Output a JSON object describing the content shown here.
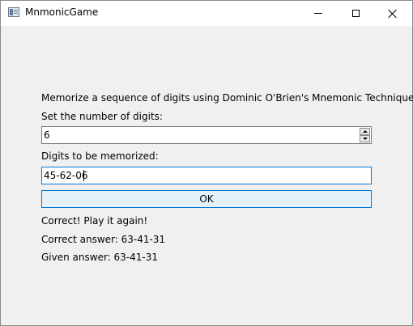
{
  "window": {
    "title": "MnmonicGame"
  },
  "form": {
    "intro": "Memorize a sequence of digits using Dominic O'Brien's Mnemonic Technique",
    "count_label": "Set the number of digits:",
    "count_value": "6",
    "digits_label": "Digits to be memorized:",
    "digits_value": "45-62-06",
    "ok_label": "OK",
    "result_text": "Correct! Play it again!",
    "correct_answer": "Correct answer: 63-41-31",
    "given_answer": "Given answer: 63-41-31"
  }
}
